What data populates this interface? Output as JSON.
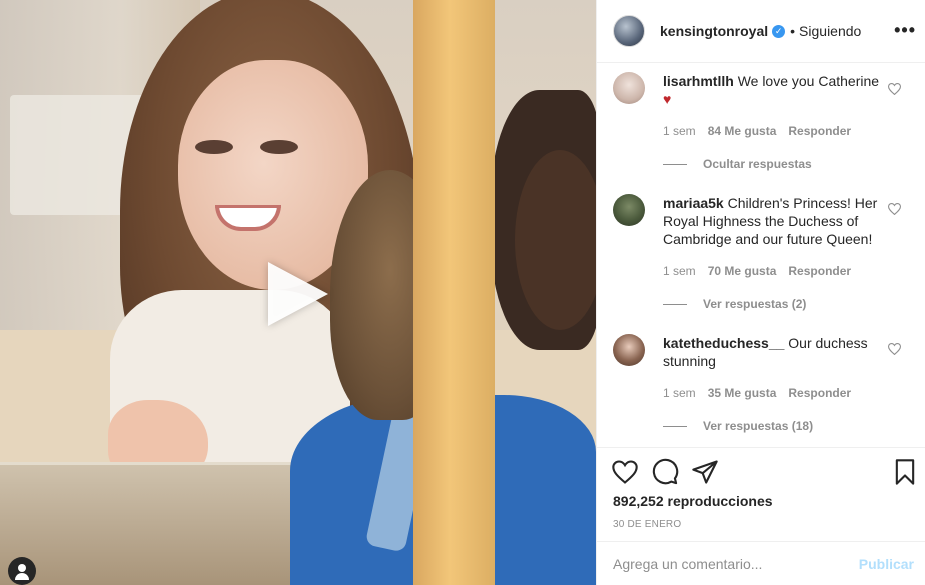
{
  "post": {
    "username": "kensingtonroyal",
    "follow_status": "Siguiendo",
    "more_icon": "more-options-icon",
    "separator": "•"
  },
  "comments": [
    {
      "username": "lisarhmtllh",
      "text": "We love you Catherine",
      "emoji": "♥",
      "time": "1 sem",
      "likes": "84 Me gusta",
      "reply": "Responder",
      "replies_label": "Ocultar respuestas",
      "avatar_color": "#d9c8c0"
    },
    {
      "username": "mariaa5k",
      "text": "Children's Princess! Her Royal Highness the Duchess of Cambridge and our future Queen!",
      "time": "1 sem",
      "likes": "70 Me gusta",
      "reply": "Responder",
      "replies_label": "Ver respuestas (2)",
      "avatar_color": "#4b5a3c"
    },
    {
      "username": "katetheduchess__",
      "text": "Our duchess stunning",
      "time": "1 sem",
      "likes": "35 Me gusta",
      "reply": "Responder",
      "replies_label": "Ver respuestas (18)",
      "avatar_color": "#6a4c3d"
    }
  ],
  "stats": {
    "views": "892,252 reproducciones",
    "date": "30 DE ENERO"
  },
  "add_comment": {
    "placeholder": "Agrega un comentario...",
    "publish_label": "Publicar"
  },
  "colors": {
    "verified": "#3897f0",
    "publish_disabled": "#b2dffc",
    "heart_emoji": "#c0282d",
    "muted_text": "#8e8e8e"
  }
}
